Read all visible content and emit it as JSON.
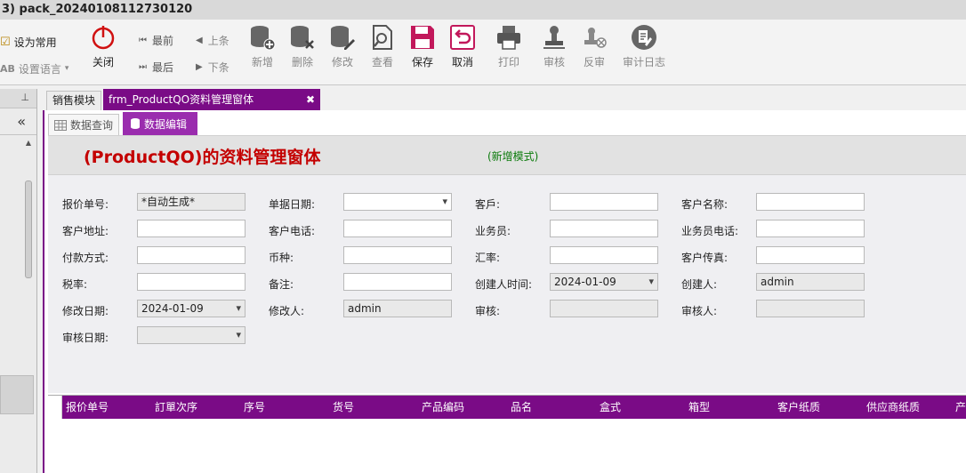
{
  "window": {
    "title": "3) pack_20240108112730120"
  },
  "ribbon": {
    "favorite": "设为常用",
    "language": "设置语言",
    "close": "关闭",
    "first": "最前",
    "prev": "上条",
    "last": "最后",
    "next": "下条",
    "buttons": [
      "新增",
      "删除",
      "修改",
      "查看",
      "保存",
      "取消",
      "打印",
      "审核",
      "反审",
      "审计日志"
    ]
  },
  "tabs": {
    "tab1": "销售模块",
    "tab2": "frm_ProductQO资料管理窗体",
    "close": "✖"
  },
  "subtabs": {
    "query": "数据查询",
    "edit": "数据编辑"
  },
  "form": {
    "title": "(ProductQO)的资料管理窗体",
    "mode": "(新增模式)",
    "labels": {
      "quote_no": "报价单号:",
      "doc_date": "单据日期:",
      "customer": "客戶:",
      "customer_name": "客户名称:",
      "address": "客户地址:",
      "phone": "客户电话:",
      "salesman": "业务员:",
      "salesman_phone": "业务员电话:",
      "payment": "付款方式:",
      "currency": "币种:",
      "rate": "汇率:",
      "fax": "客户传真:",
      "tax": "税率:",
      "remark": "备注:",
      "created_time": "创建人时间:",
      "creator": "创建人:",
      "modified_date": "修改日期:",
      "modifier": "修改人:",
      "audit": "审核:",
      "auditor": "审核人:",
      "audit_date": "审核日期:"
    },
    "values": {
      "quote_no": "*自动生成*",
      "created_time": "2024-01-09",
      "creator": "admin",
      "modified_date": "2024-01-09",
      "modifier": "admin"
    }
  },
  "grid": {
    "columns": [
      "报价单号",
      "訂單次序",
      "序号",
      "货号",
      "产品编码",
      "品名",
      "盒式",
      "箱型",
      "客户纸质",
      "供应商纸质",
      "产"
    ]
  }
}
